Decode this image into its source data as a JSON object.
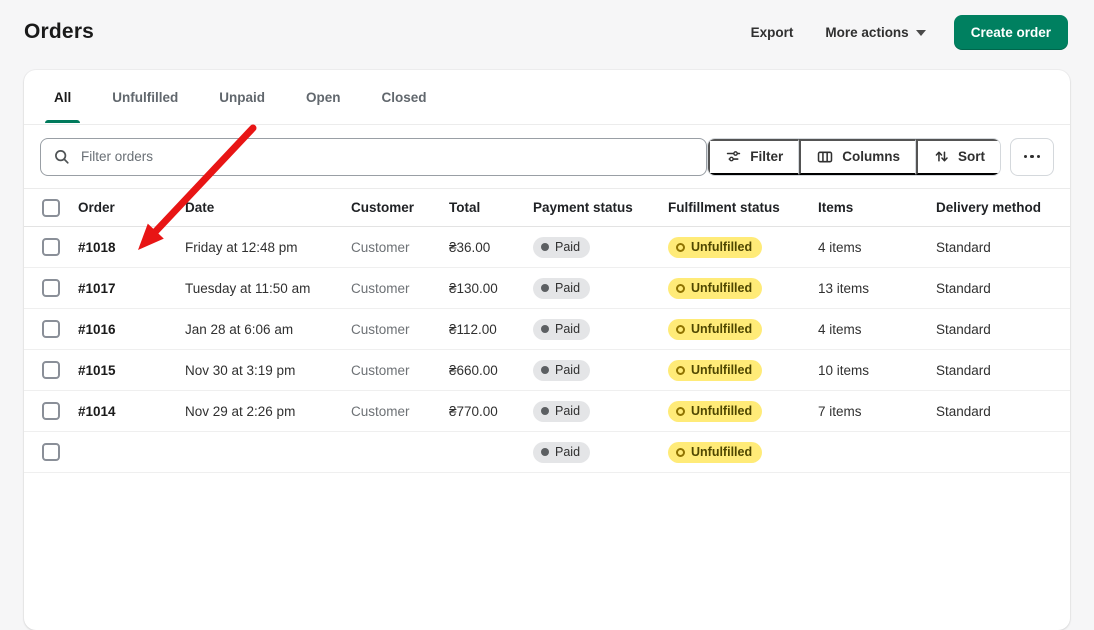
{
  "colors": {
    "accent_green": "#007a5c",
    "create_button_green": "#008060",
    "badge_yellow": "#ffeb78",
    "badge_gray": "#e4e5e7",
    "arrow_red": "#e81515"
  },
  "page": {
    "title": "Orders"
  },
  "header_actions": {
    "export": "Export",
    "more_actions": "More actions",
    "create_order": "Create order"
  },
  "tabs": [
    {
      "label": "All",
      "active": true
    },
    {
      "label": "Unfulfilled",
      "active": false
    },
    {
      "label": "Unpaid",
      "active": false
    },
    {
      "label": "Open",
      "active": false
    },
    {
      "label": "Closed",
      "active": false
    }
  ],
  "filter_bar": {
    "search_placeholder": "Filter orders",
    "filter": "Filter",
    "columns": "Columns",
    "sort": "Sort"
  },
  "table": {
    "headers": [
      "Order",
      "Date",
      "Customer",
      "Total",
      "Payment status",
      "Fulfillment status",
      "Items",
      "Delivery method"
    ],
    "rows": [
      {
        "order": "#1018",
        "date": "Friday at 12:48 pm",
        "customer": "Customer",
        "total": "₴36.00",
        "payment_status": "Paid",
        "fulfillment_status": "Unfulfilled",
        "items": "4 items",
        "delivery_method": "Standard"
      },
      {
        "order": "#1017",
        "date": "Tuesday at 11:50 am",
        "customer": "Customer",
        "total": "₴130.00",
        "payment_status": "Paid",
        "fulfillment_status": "Unfulfilled",
        "items": "13 items",
        "delivery_method": "Standard"
      },
      {
        "order": "#1016",
        "date": "Jan 28 at 6:06 am",
        "customer": "Customer",
        "total": "₴112.00",
        "payment_status": "Paid",
        "fulfillment_status": "Unfulfilled",
        "items": "4 items",
        "delivery_method": "Standard"
      },
      {
        "order": "#1015",
        "date": "Nov 30 at 3:19 pm",
        "customer": "Customer",
        "total": "₴660.00",
        "payment_status": "Paid",
        "fulfillment_status": "Unfulfilled",
        "items": "10 items",
        "delivery_method": "Standard"
      },
      {
        "order": "#1014",
        "date": "Nov 29 at 2:26 pm",
        "customer": "Customer",
        "total": "₴770.00",
        "payment_status": "Paid",
        "fulfillment_status": "Unfulfilled",
        "items": "7 items",
        "delivery_method": "Standard"
      }
    ],
    "partial_row": {
      "order": "",
      "date": "",
      "customer": "",
      "total": "",
      "payment_status": "Paid",
      "fulfillment_status": "Unfulfilled",
      "items": "",
      "delivery_method": ""
    }
  }
}
